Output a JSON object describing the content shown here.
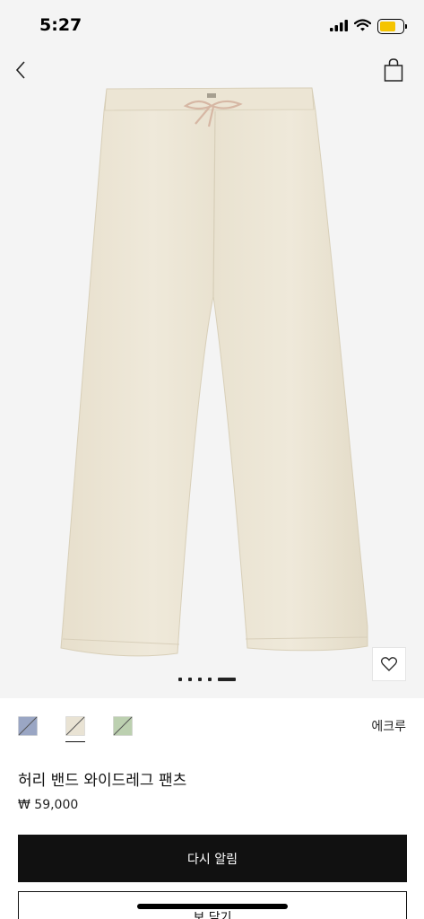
{
  "status_bar": {
    "time": "5:27",
    "battery_level": 0.7,
    "battery_color": "#f5c400"
  },
  "nav": {
    "back_icon": "chevron-left-icon",
    "bag_icon": "shopping-bag-icon"
  },
  "gallery": {
    "image": "cream-wide-leg-trousers",
    "page_count": 5,
    "current_page": 5
  },
  "wishlist": {
    "icon": "heart-icon"
  },
  "colors": {
    "swatches": [
      {
        "hex": "#9aa6c4",
        "selected": false
      },
      {
        "hex": "#e9e3d4",
        "selected": true
      },
      {
        "hex": "#bcd0b0",
        "selected": false
      }
    ],
    "selected_name": "에크루"
  },
  "product": {
    "name": "허리 밴드 와이드레그 팬츠",
    "price": "₩ 59,000"
  },
  "actions": {
    "notify_label": "다시 알림",
    "secondary_label": "보 닫기"
  },
  "theme": {
    "accent": "#111111",
    "background": "#f4f4f4"
  }
}
